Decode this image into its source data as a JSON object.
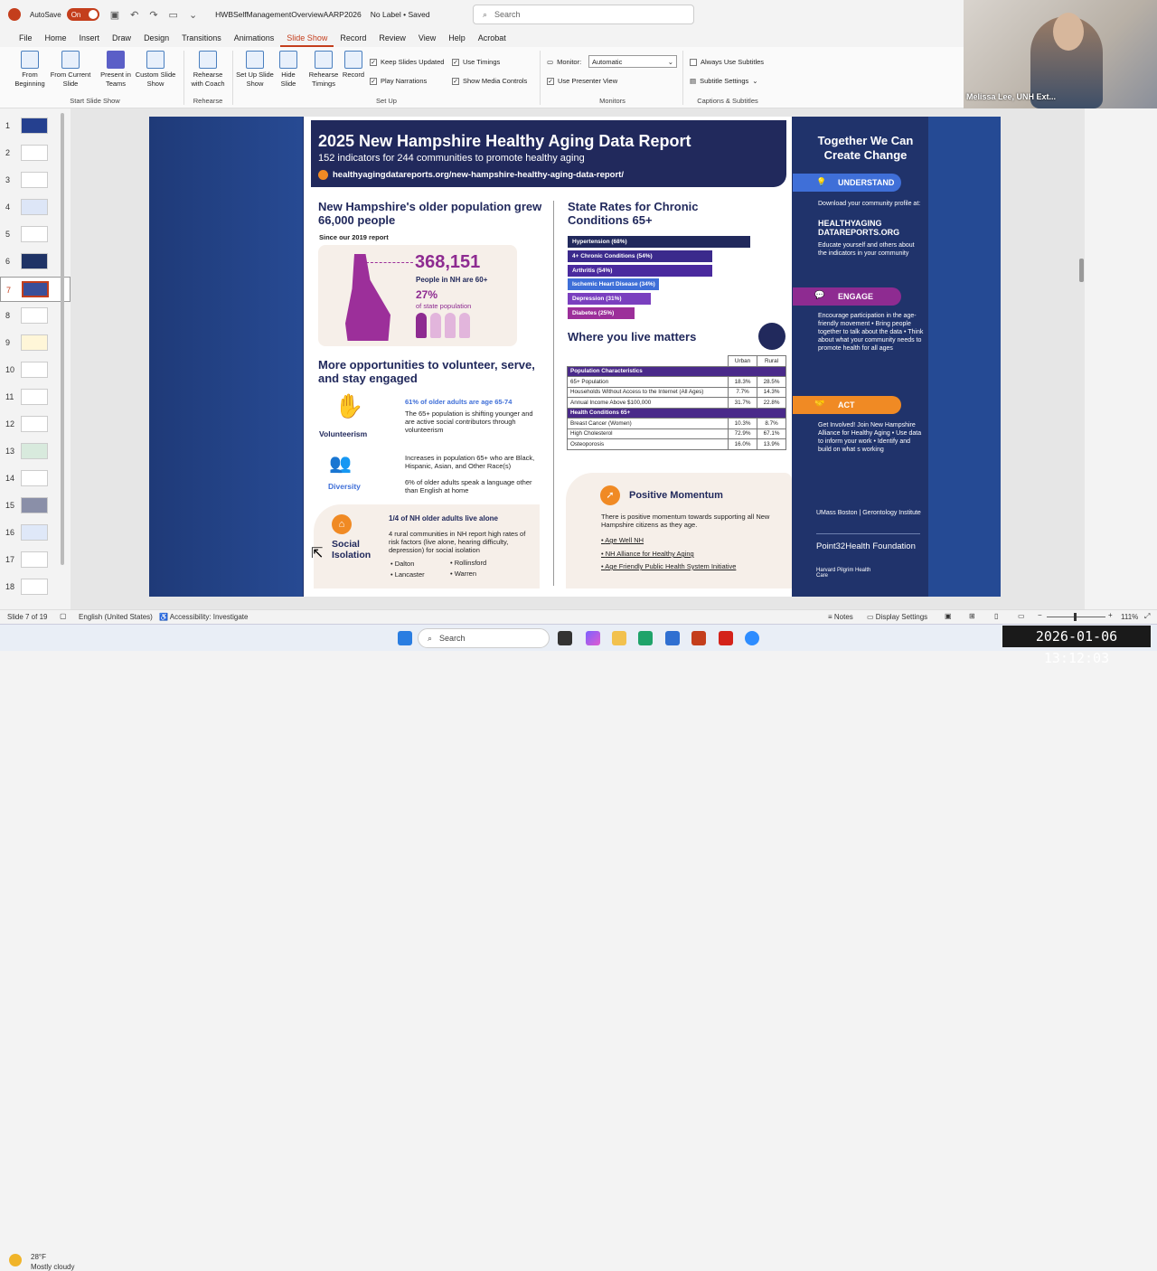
{
  "titlebar": {
    "autosave_label": "AutoSave",
    "autosave_state": "On",
    "filename": "HWBSelfManagementOverviewAARP2026",
    "label_status": "No Label • Saved",
    "search_placeholder": "Search"
  },
  "menu": [
    "File",
    "Home",
    "Insert",
    "Draw",
    "Design",
    "Transitions",
    "Animations",
    "Slide Show",
    "Record",
    "Review",
    "View",
    "Help",
    "Acrobat"
  ],
  "ribbon": {
    "from_beginning": "From Beginning",
    "from_current": "From Current Slide",
    "present_teams": "Present in Teams",
    "custom_show": "Custom Slide Show",
    "group_start": "Start Slide Show",
    "rehearse_coach": "Rehearse with Coach",
    "group_rehearse": "Rehearse",
    "setup_show": "Set Up Slide Show",
    "hide_slide": "Hide Slide",
    "rehearse_timings": "Rehearse Timings",
    "record": "Record",
    "keep_updated": "Keep Slides Updated",
    "use_timings": "Use Timings",
    "play_narrations": "Play Narrations",
    "show_media": "Show Media Controls",
    "group_setup": "Set Up",
    "monitor_label": "Monitor:",
    "monitor_value": "Automatic",
    "presenter_view": "Use Presenter View",
    "group_monitors": "Monitors",
    "always_subtitles": "Always Use Subtitles",
    "subtitle_settings": "Subtitle Settings",
    "group_captions": "Captions & Subtitles"
  },
  "webcam": {
    "name": "Melissa Lee, UNH Ext..."
  },
  "thumbnails": [
    "1",
    "2",
    "3",
    "4",
    "5",
    "6",
    "7",
    "8",
    "9",
    "10",
    "11",
    "12",
    "13",
    "14",
    "15",
    "16",
    "17",
    "18"
  ],
  "poster": {
    "title": "2025 New Hampshire Healthy Aging Data Report",
    "subtitle": "152 indicators for 244 communities to promote healthy aging",
    "url": "healthyagingdatareports.org/new-hampshire-healthy-aging-data-report/",
    "growth_heading": "New Hampshire's older population grew 66,000 people",
    "since": "Since our 2019 report",
    "population_number": "368,151",
    "population_label": "People in NH are 60+",
    "percent": "27%",
    "percent_label": "of state population",
    "opp_heading": "More opportunities to volunteer, serve, and stay engaged",
    "vol_stat": "61% of older adults are age 65-74",
    "vol_text": "The 65+ population is shifting younger and are active social contributors through volunteerism",
    "vol_label": "Volunteerism",
    "div_stat": "Increases in population 65+ who are Black, Hispanic, Asian, and Other Race(s)",
    "div_stat2": "6% of older adults speak a language other than English at home",
    "div_label": "Diversity",
    "iso_stat": "1/4 of NH older adults live alone",
    "iso_text": "4 rural communities in NH report high rates of risk factors (live alone, hearing difficulty, depression) for social isolation",
    "iso_label": "Social Isolation",
    "towns": [
      "Dalton",
      "Rollinsford",
      "Lancaster",
      "Warren"
    ],
    "chronic_heading": "State Rates for Chronic Conditions 65+",
    "live_heading": "Where you live matters",
    "momentum_title": "Positive Momentum",
    "momentum_text": "There is positive momentum towards supporting all New Hampshire citizens as they age.",
    "momentum_links": [
      "Age Well NH",
      "NH Alliance for Healthy Aging",
      "Age Friendly Public Health System Initiative"
    ]
  },
  "chart_data": {
    "type": "bar",
    "title": "State Rates for Chronic Conditions 65+",
    "categories": [
      "Hypertension",
      "4+ Chronic Conditions",
      "Arthritis",
      "Ischemic Heart Disease",
      "Depression",
      "Diabetes"
    ],
    "labels": [
      "Hypertension (68%)",
      "4+ Chronic Conditions (54%)",
      "Arthritis (54%)",
      "Ischemic Heart Disease (34%)",
      "Depression (31%)",
      "Diabetes (25%)"
    ],
    "values": [
      68,
      54,
      54,
      34,
      31,
      25
    ],
    "colors": [
      "#21295c",
      "#3b2a8c",
      "#4a2a9e",
      "#3f6fd8",
      "#7a3fbf",
      "#9c2f9a"
    ]
  },
  "table": {
    "headers": [
      "",
      "Urban",
      "Rural"
    ],
    "rows": [
      {
        "section": "Population Characteristics"
      },
      {
        "label": "65+ Population",
        "urban": "18.3%",
        "rural": "28.5%"
      },
      {
        "label": "Households Without Access to the Internet (All Ages)",
        "urban": "7.7%",
        "rural": "14.3%"
      },
      {
        "label": "Annual Income Above $100,000",
        "urban": "31.7%",
        "rural": "22.8%"
      },
      {
        "section": "Health Conditions 65+"
      },
      {
        "label": "Breast Cancer (Women)",
        "urban": "10.3%",
        "rural": "8.7%"
      },
      {
        "label": "High Cholesterol",
        "urban": "72.9%",
        "rural": "67.1%"
      },
      {
        "label": "Osteoporosis",
        "urban": "16.0%",
        "rural": "13.9%"
      }
    ]
  },
  "right_panel": {
    "title": "Together We Can Create Change",
    "understand": "UNDERSTAND",
    "understand_text1": "Download your community profile at:",
    "understand_site": "HEALTHYAGING DATAREPORTS.ORG",
    "understand_text2": "Educate yourself and others about the indicators in your community",
    "engage": "ENGAGE",
    "engage_text": "Encourage participation in the age-friendly movement • Bring people together to talk about the data • Think about what your community needs to promote health for all ages",
    "act": "ACT",
    "act_text": "Get Involved! Join New Hampshire Alliance for Healthy Aging • Use data to inform your work • Identify and build on what s working",
    "logo1": "UMass Boston | Gerontology Institute",
    "logo2": "Point32Health Foundation",
    "logo3": "Harvard Pilgrim Health Care"
  },
  "status": {
    "slide_info": "Slide 7 of 19",
    "language": "English (United States)",
    "accessibility": "Accessibility: Investigate",
    "notes": "Notes",
    "display_settings": "Display Settings",
    "zoom": "111%"
  },
  "taskbar": {
    "temp": "28°F",
    "weather": "Mostly cloudy",
    "search": "Search",
    "datetime": "2026-01-06 13:12:03"
  }
}
